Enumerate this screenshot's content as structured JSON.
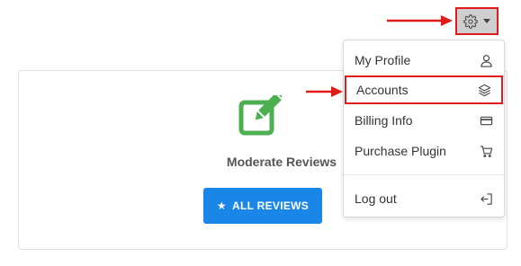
{
  "card": {
    "title": "Moderate Reviews",
    "button_label": "ALL REVIEWS",
    "button_icon": "star-icon",
    "icon": "edit-icon"
  },
  "settings_button": {
    "icon": "gear-icon",
    "caret": "caret-down-icon"
  },
  "menu": {
    "items": [
      {
        "label": "My Profile",
        "icon": "user-icon"
      },
      {
        "label": "Accounts",
        "icon": "layers-icon",
        "highlighted": true
      },
      {
        "label": "Billing Info",
        "icon": "credit-card-icon"
      },
      {
        "label": "Purchase Plugin",
        "icon": "cart-icon"
      },
      {
        "label": "Log out",
        "icon": "logout-icon"
      }
    ]
  },
  "colors": {
    "accent": "#1a87e8",
    "edit_icon": "#4caf50",
    "highlight_border": "#e11b1b",
    "annotation_arrow": "#e11b1b"
  }
}
